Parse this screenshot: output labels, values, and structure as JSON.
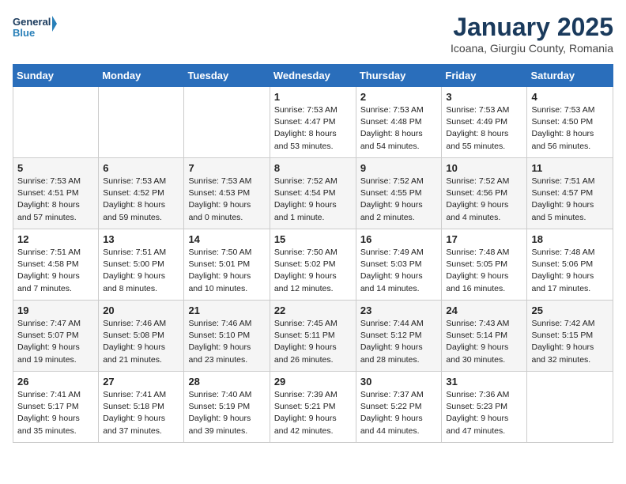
{
  "header": {
    "logo_line1": "General",
    "logo_line2": "Blue",
    "title": "January 2025",
    "subtitle": "Icoana, Giurgiu County, Romania"
  },
  "weekdays": [
    "Sunday",
    "Monday",
    "Tuesday",
    "Wednesday",
    "Thursday",
    "Friday",
    "Saturday"
  ],
  "weeks": [
    [
      {
        "day": "",
        "info": ""
      },
      {
        "day": "",
        "info": ""
      },
      {
        "day": "",
        "info": ""
      },
      {
        "day": "1",
        "info": "Sunrise: 7:53 AM\nSunset: 4:47 PM\nDaylight: 8 hours\nand 53 minutes."
      },
      {
        "day": "2",
        "info": "Sunrise: 7:53 AM\nSunset: 4:48 PM\nDaylight: 8 hours\nand 54 minutes."
      },
      {
        "day": "3",
        "info": "Sunrise: 7:53 AM\nSunset: 4:49 PM\nDaylight: 8 hours\nand 55 minutes."
      },
      {
        "day": "4",
        "info": "Sunrise: 7:53 AM\nSunset: 4:50 PM\nDaylight: 8 hours\nand 56 minutes."
      }
    ],
    [
      {
        "day": "5",
        "info": "Sunrise: 7:53 AM\nSunset: 4:51 PM\nDaylight: 8 hours\nand 57 minutes."
      },
      {
        "day": "6",
        "info": "Sunrise: 7:53 AM\nSunset: 4:52 PM\nDaylight: 8 hours\nand 59 minutes."
      },
      {
        "day": "7",
        "info": "Sunrise: 7:53 AM\nSunset: 4:53 PM\nDaylight: 9 hours\nand 0 minutes."
      },
      {
        "day": "8",
        "info": "Sunrise: 7:52 AM\nSunset: 4:54 PM\nDaylight: 9 hours\nand 1 minute."
      },
      {
        "day": "9",
        "info": "Sunrise: 7:52 AM\nSunset: 4:55 PM\nDaylight: 9 hours\nand 2 minutes."
      },
      {
        "day": "10",
        "info": "Sunrise: 7:52 AM\nSunset: 4:56 PM\nDaylight: 9 hours\nand 4 minutes."
      },
      {
        "day": "11",
        "info": "Sunrise: 7:51 AM\nSunset: 4:57 PM\nDaylight: 9 hours\nand 5 minutes."
      }
    ],
    [
      {
        "day": "12",
        "info": "Sunrise: 7:51 AM\nSunset: 4:58 PM\nDaylight: 9 hours\nand 7 minutes."
      },
      {
        "day": "13",
        "info": "Sunrise: 7:51 AM\nSunset: 5:00 PM\nDaylight: 9 hours\nand 8 minutes."
      },
      {
        "day": "14",
        "info": "Sunrise: 7:50 AM\nSunset: 5:01 PM\nDaylight: 9 hours\nand 10 minutes."
      },
      {
        "day": "15",
        "info": "Sunrise: 7:50 AM\nSunset: 5:02 PM\nDaylight: 9 hours\nand 12 minutes."
      },
      {
        "day": "16",
        "info": "Sunrise: 7:49 AM\nSunset: 5:03 PM\nDaylight: 9 hours\nand 14 minutes."
      },
      {
        "day": "17",
        "info": "Sunrise: 7:48 AM\nSunset: 5:05 PM\nDaylight: 9 hours\nand 16 minutes."
      },
      {
        "day": "18",
        "info": "Sunrise: 7:48 AM\nSunset: 5:06 PM\nDaylight: 9 hours\nand 17 minutes."
      }
    ],
    [
      {
        "day": "19",
        "info": "Sunrise: 7:47 AM\nSunset: 5:07 PM\nDaylight: 9 hours\nand 19 minutes."
      },
      {
        "day": "20",
        "info": "Sunrise: 7:46 AM\nSunset: 5:08 PM\nDaylight: 9 hours\nand 21 minutes."
      },
      {
        "day": "21",
        "info": "Sunrise: 7:46 AM\nSunset: 5:10 PM\nDaylight: 9 hours\nand 23 minutes."
      },
      {
        "day": "22",
        "info": "Sunrise: 7:45 AM\nSunset: 5:11 PM\nDaylight: 9 hours\nand 26 minutes."
      },
      {
        "day": "23",
        "info": "Sunrise: 7:44 AM\nSunset: 5:12 PM\nDaylight: 9 hours\nand 28 minutes."
      },
      {
        "day": "24",
        "info": "Sunrise: 7:43 AM\nSunset: 5:14 PM\nDaylight: 9 hours\nand 30 minutes."
      },
      {
        "day": "25",
        "info": "Sunrise: 7:42 AM\nSunset: 5:15 PM\nDaylight: 9 hours\nand 32 minutes."
      }
    ],
    [
      {
        "day": "26",
        "info": "Sunrise: 7:41 AM\nSunset: 5:17 PM\nDaylight: 9 hours\nand 35 minutes."
      },
      {
        "day": "27",
        "info": "Sunrise: 7:41 AM\nSunset: 5:18 PM\nDaylight: 9 hours\nand 37 minutes."
      },
      {
        "day": "28",
        "info": "Sunrise: 7:40 AM\nSunset: 5:19 PM\nDaylight: 9 hours\nand 39 minutes."
      },
      {
        "day": "29",
        "info": "Sunrise: 7:39 AM\nSunset: 5:21 PM\nDaylight: 9 hours\nand 42 minutes."
      },
      {
        "day": "30",
        "info": "Sunrise: 7:37 AM\nSunset: 5:22 PM\nDaylight: 9 hours\nand 44 minutes."
      },
      {
        "day": "31",
        "info": "Sunrise: 7:36 AM\nSunset: 5:23 PM\nDaylight: 9 hours\nand 47 minutes."
      },
      {
        "day": "",
        "info": ""
      }
    ]
  ]
}
